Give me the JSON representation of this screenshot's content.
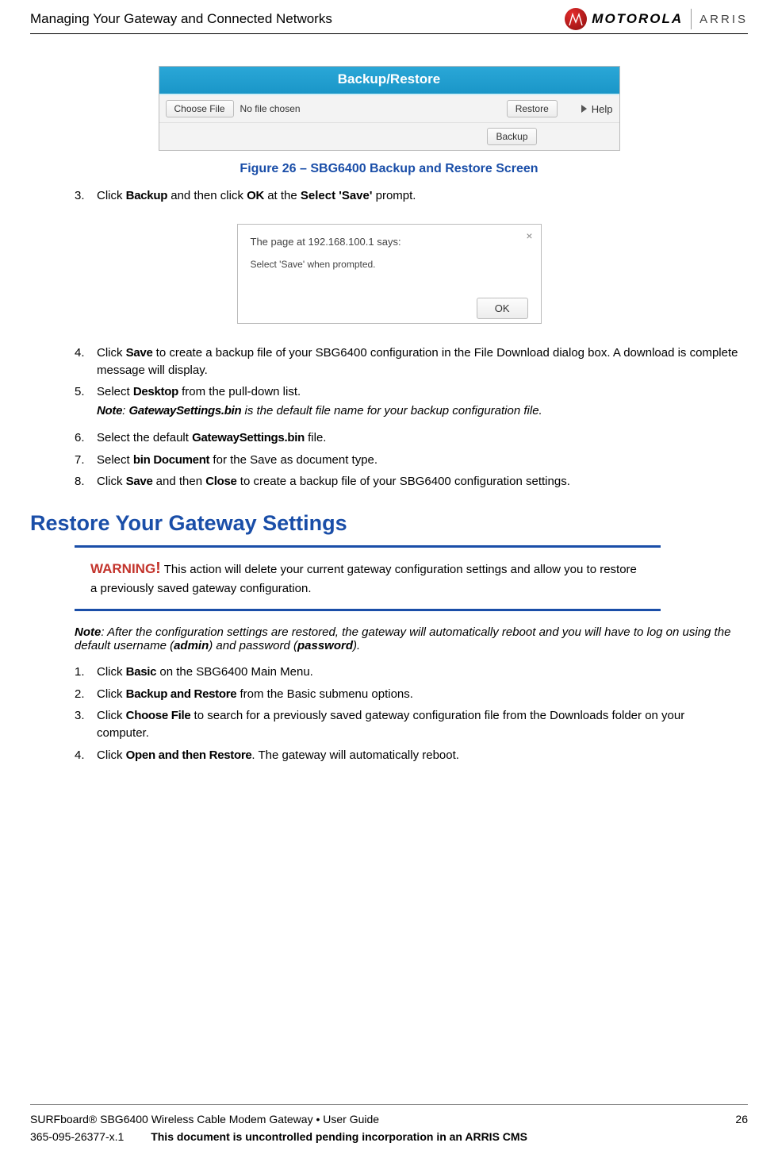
{
  "header": {
    "title": "Managing Your Gateway and Connected Networks",
    "brand_motorola": "MOTOROLA",
    "brand_arris": "ARRIS"
  },
  "figure26": {
    "bar_title": "Backup/Restore",
    "choose_file_btn": "Choose File",
    "no_file_text": "No file chosen",
    "restore_btn": "Restore",
    "backup_btn": "Backup",
    "help_label": "Help",
    "caption": "Figure 26 – SBG6400 Backup and Restore Screen"
  },
  "stepsA": {
    "s3_num": "3.",
    "s3_a": "Click ",
    "s3_b_cond": "Backup",
    "s3_c": " and then click ",
    "s3_d_cond": "OK",
    "s3_e": " at the ",
    "s3_f_bold": "Select 'Save'",
    "s3_g": " prompt."
  },
  "dialog": {
    "title": "The page at 192.168.100.1 says:",
    "msg": "Select 'Save' when prompted.",
    "ok": "OK"
  },
  "stepsB": {
    "s4_num": "4.",
    "s4_a": "Click ",
    "s4_b": "Save",
    "s4_c": " to create a backup file of your SBG6400 configuration in the File Download dialog box. A download is complete message will display.",
    "s5_num": "5.",
    "s5_a": "Select ",
    "s5_b": "Desktop",
    "s5_c": " from the pull-down list.",
    "s5_note_lead": "Note",
    "s5_note_a": ": ",
    "s5_note_b": "GatewaySettings.bin",
    "s5_note_c": " is the default file name for your backup configuration file.",
    "s6_num": "6.",
    "s6_a": "Select the default ",
    "s6_b": "GatewaySettings.bin",
    "s6_c": " file.",
    "s7_num": "7.",
    "s7_a": "Select ",
    "s7_b": "bin Document",
    "s7_c": " for the Save as document type.",
    "s8_num": "8.",
    "s8_a": "Click ",
    "s8_b": "Save",
    "s8_c": " and then ",
    "s8_d": "Close",
    "s8_e": " to create a backup file of your SBG6400 configuration settings."
  },
  "section2": {
    "title": "Restore Your Gateway Settings"
  },
  "warning": {
    "lead": "WARNING",
    "bang": "!",
    "text": " This action will delete your current gateway configuration settings and allow you to restore a previously saved gateway configuration."
  },
  "note2": {
    "lead": "Note",
    "a": ": After the configuration settings are restored, the gateway will automatically reboot and you will have to log on using the default username (",
    "b": "admin",
    "c": ") and password (",
    "d": "password",
    "e": ")."
  },
  "stepsC": {
    "s1_num": "1.",
    "s1_a": "Click ",
    "s1_b": "Basic",
    "s1_c": " on the SBG6400 Main Menu.",
    "s2_num": "2.",
    "s2_a": "Click ",
    "s2_b": "Backup and Restore",
    "s2_c": " from the Basic submenu options.",
    "s3_num": "3.",
    "s3_a": "Click ",
    "s3_b": "Choose File",
    "s3_c": " to search for a previously saved gateway configuration file from the Downloads folder on your computer.",
    "s4_num": "4.",
    "s4_a": "Click ",
    "s4_b": "Open",
    "s4_c": " and then ",
    "s4_d": "Restore",
    "s4_e": ". The gateway will automatically reboot."
  },
  "footer": {
    "product": "SURFboard® SBG6400 Wireless Cable Modem Gateway • User Guide",
    "page_num": "26",
    "doc_id": "365-095-26377-x.1",
    "notice": "This document is uncontrolled pending incorporation in an ARRIS CMS"
  }
}
